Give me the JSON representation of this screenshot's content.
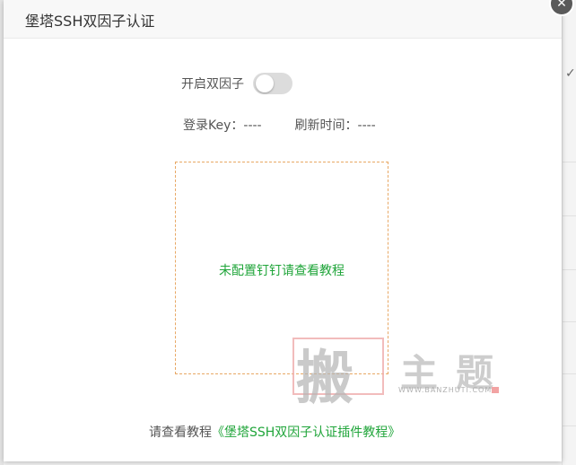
{
  "dialog": {
    "title": "堡塔SSH双因子认证",
    "close_icon": "close-icon"
  },
  "toggle": {
    "label": "开启双因子",
    "enabled": false
  },
  "info": {
    "login_key_label": "登录Key：",
    "login_key_value": "----",
    "refresh_time_label": "刷新时间：",
    "refresh_time_value": "----"
  },
  "qr_area": {
    "message": "未配置钉钉请查看教程"
  },
  "footer": {
    "prefix": "请查看教程",
    "link_text": "《堡塔SSH双因子认证插件教程》"
  },
  "watermark": {
    "big_char": "搬",
    "char1": "主",
    "char2": "题",
    "url": "WWW.BANZHUTI.COM"
  },
  "colors": {
    "accent_green": "#20a53a",
    "dashed_border": "#e8a865",
    "switch_off": "#dcdcdc"
  }
}
